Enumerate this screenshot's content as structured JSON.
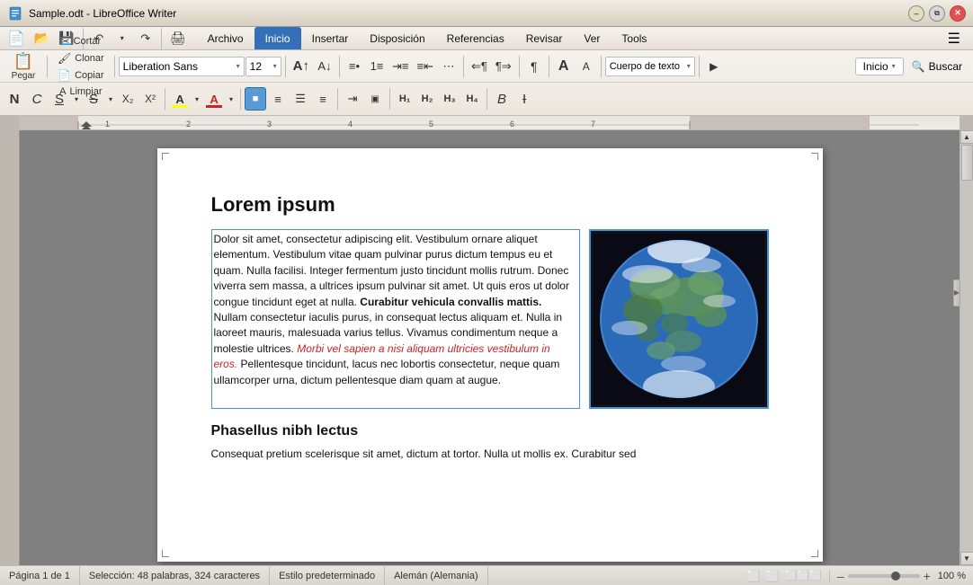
{
  "titlebar": {
    "title": "Sample.odt - LibreOffice Writer",
    "app_icon": "LO"
  },
  "menubar": {
    "items": [
      {
        "label": "Archivo",
        "active": false
      },
      {
        "label": "Inicio",
        "active": true
      },
      {
        "label": "Insertar",
        "active": false
      },
      {
        "label": "Disposición",
        "active": false
      },
      {
        "label": "Referencias",
        "active": false
      },
      {
        "label": "Revisar",
        "active": false
      },
      {
        "label": "Ver",
        "active": false
      },
      {
        "label": "Tools",
        "active": false
      }
    ]
  },
  "toolbar1": {
    "new_label": "📄",
    "open_label": "📂",
    "save_label": "💾",
    "undo_label": "↶",
    "redo_label": "↷",
    "print_label": "🖨",
    "paste_label": "Pegar",
    "cut_label": "Cortar",
    "clone_label": "Clonar",
    "copy_label": "Copiar",
    "clear_label": "Limpiar",
    "font_name": "Liberation Sans",
    "font_size": "12",
    "grow_label": "A",
    "shrink_label": "A",
    "style_name": "Cuerpo de texto",
    "inicio_label": "Inicio",
    "buscar_label": "Buscar"
  },
  "toolbar2": {
    "bold_label": "N",
    "italic_label": "C",
    "underline_label": "S",
    "strikethrough_label": "S",
    "sub_label": "X₂",
    "sup_label": "X²",
    "highlight_label": "A",
    "font_color_label": "A",
    "align_left": "≡",
    "align_center": "≡",
    "align_right": "≡",
    "h1_label": "H1",
    "h2_label": "H2",
    "h3_label": "H3",
    "h4_label": "H4",
    "bold_icon_label": "B",
    "italic_icon_label": "I"
  },
  "document": {
    "title": "Lorem ipsum",
    "paragraph1_part1": "Dolor sit amet, consectetur adipiscing elit. Vestibulum ornare aliquet elementum. Vestibulum vitae quam pulvinar purus dictum tempus eu et quam. Nulla facilisi. Integer fermentum justo tincidunt mollis rutrum. Donec viverra sem massa, a ultrices ipsum pulvinar sit amet. Ut quis eros ut dolor congue tincidunt eget at nulla.",
    "paragraph1_bold": " Curabitur vehicula convallis mattis.",
    "paragraph1_part2": " Nullam consectetur iaculis purus, in consequat lectus aliquam et. Nulla in laoreet mauris, malesuada varius tellus. Vivamus condimentum neque a molestie ultrices.",
    "paragraph1_red": " Morbi vel sapien a nisi aliquam ultricies vestibulum in eros.",
    "paragraph1_part3": " Pellentesque tincidunt, lacus nec lobortis consectetur, neque quam ullamcorper urna, dictum pellentesque diam quam at augue.",
    "subtitle2": "Phasellus nibh lectus",
    "paragraph2": "Consequat pretium scelerisque sit amet, dictum at tortor. Nulla ut mollis ex. Curabitur sed"
  },
  "statusbar": {
    "page_info": "Página 1 de 1",
    "selection": "Selección: 48 palabras, 324 caracteres",
    "style": "Estilo predeterminado",
    "language": "Alemán (Alemania)",
    "zoom": "100 %"
  }
}
